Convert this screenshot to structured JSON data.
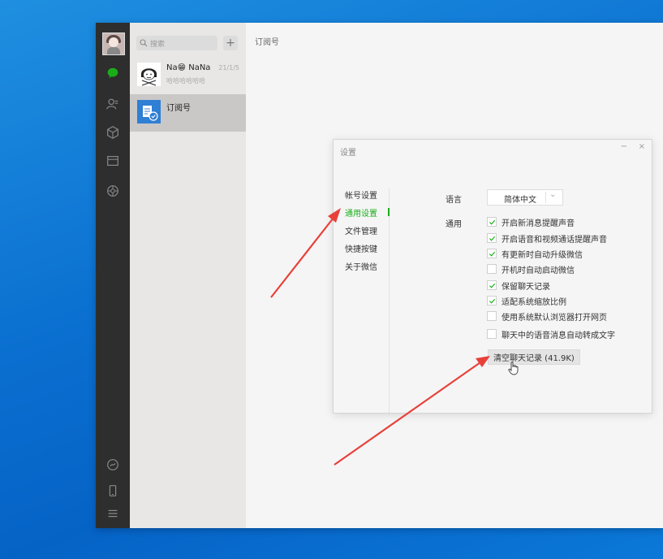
{
  "search": {
    "placeholder": "搜索",
    "add_label": "+"
  },
  "chats": [
    {
      "name": "Na😁 NaNa",
      "time": "21/1/5",
      "preview": "哈哈哈哈哈哈"
    },
    {
      "name": "订阅号"
    }
  ],
  "main": {
    "title": "订阅号"
  },
  "settings": {
    "title": "设置",
    "minimize": "−",
    "close": "×",
    "nav": [
      "帐号设置",
      "通用设置",
      "文件管理",
      "快捷按键",
      "关于微信"
    ],
    "active_nav": "通用设置",
    "language_label": "语言",
    "language_value": "简体中文",
    "language_arrow": "⌄",
    "general_label": "通用",
    "options": [
      {
        "label": "开启新消息提醒声音",
        "checked": true
      },
      {
        "label": "开启语音和视频通话提醒声音",
        "checked": true
      },
      {
        "label": "有更新时自动升级微信",
        "checked": true
      },
      {
        "label": "开机时自动启动微信",
        "checked": false
      },
      {
        "label": "保留聊天记录",
        "checked": true
      },
      {
        "label": "适配系统缩放比例",
        "checked": true
      },
      {
        "label": "使用系统默认浏览器打开网页",
        "checked": false
      },
      {
        "label": "聊天中的语音消息自动转成文字",
        "checked": false
      }
    ],
    "clear_button": "清空聊天记录 (41.9K)"
  },
  "colors": {
    "accent": "#1aad19",
    "arrow": "#e8413a",
    "sidebar": "#2e2e2e",
    "desktop": "#0a6fd0"
  },
  "icons": [
    "chat-icon",
    "contacts-icon",
    "favorites-icon",
    "files-icon",
    "moments-icon",
    "miniprogram-icon",
    "phone-icon",
    "menu-icon",
    "search-icon"
  ]
}
